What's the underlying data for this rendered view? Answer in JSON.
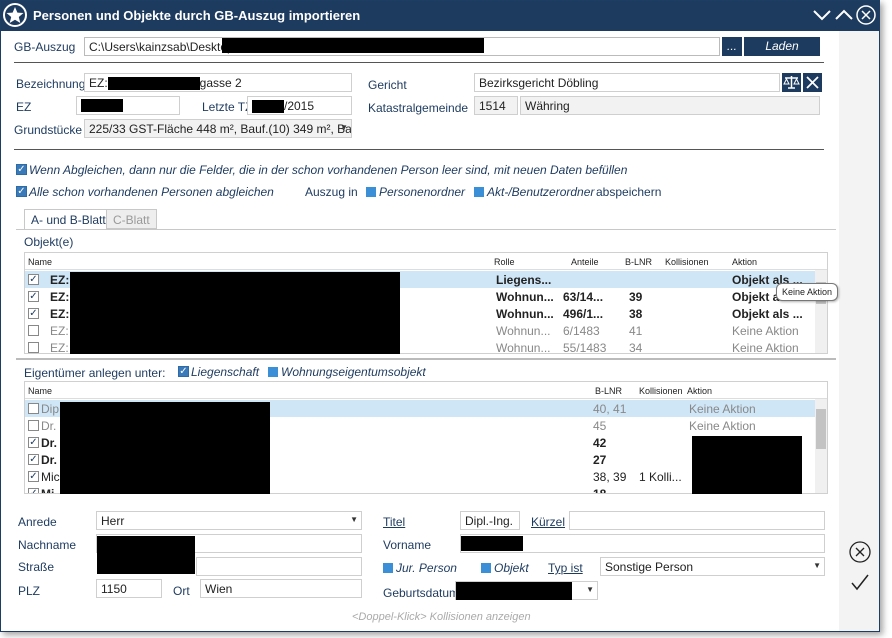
{
  "window": {
    "title": "Personen und Objekte durch GB-Auszug importieren"
  },
  "colors": {
    "titlebar": "#1d3a5f",
    "accent": "#3a8fd6",
    "selection": "#cfe6f7"
  },
  "gb": {
    "label": "GB-Auszug",
    "path": "C:\\Users\\kainzsab\\Desktop\\",
    "browse": "...",
    "load": "Laden"
  },
  "bez": {
    "label": "Bezeichnung",
    "prefix": "EZ:",
    "suffix": "gasse 2"
  },
  "gericht": {
    "label": "Gericht",
    "value": "Bezirksgericht Döbling"
  },
  "ez": {
    "label": "EZ",
    "letzte_tz_label": "Letzte TZ",
    "letzte_tz_suffix": "/2015"
  },
  "kg": {
    "label": "Katastralgemeinde",
    "code": "1514",
    "name": "Währing"
  },
  "grund": {
    "label": "Grundstücke",
    "value": "225/33 GST-Fläche 448 m², Bauf.(10) 349 m², Ba..."
  },
  "opts": {
    "abgleich": "Wenn Abgleichen, dann nur die Felder, die in der schon vorhandenen Person leer sind, mit neuen Daten befüllen",
    "alle": "Alle schon vorhandenen Personen abgleichen",
    "auszug_in": "Auszug in",
    "personenordner": "Personenordner",
    "akt": "Akt-/Benutzerordner",
    "speichern": "abspeichern"
  },
  "tabs": [
    "A- und B-Blatt",
    "C-Blatt"
  ],
  "objekte": {
    "label": "Objekt(e)",
    "headers": [
      "Name",
      "Rolle",
      "Anteile",
      "B-LNR",
      "Kollisionen",
      "Aktion"
    ],
    "rows": [
      {
        "checked": true,
        "name": "EZ:",
        "rolle": "Liegens...",
        "anteile": "",
        "blnr": "",
        "koll": "",
        "aktion": "Objekt als ...",
        "style": "sel bold"
      },
      {
        "checked": true,
        "name": "EZ:",
        "rolle": "Wohnun...",
        "anteile": "63/14...",
        "blnr": "39",
        "koll": "",
        "aktion": "Objekt a",
        "style": "bold"
      },
      {
        "checked": true,
        "name": "EZ:",
        "rolle": "Wohnun...",
        "anteile": "496/1...",
        "blnr": "38",
        "koll": "",
        "aktion": "Objekt als ...",
        "style": "bold"
      },
      {
        "checked": false,
        "name": "EZ:",
        "rolle": "Wohnun...",
        "anteile": "6/1483",
        "blnr": "41",
        "koll": "",
        "aktion": "Keine Aktion",
        "style": "dim"
      },
      {
        "checked": false,
        "name": "EZ:",
        "rolle": "Wohnun...",
        "anteile": "55/1483",
        "blnr": "34",
        "koll": "",
        "aktion": "Keine Aktion",
        "style": "dim"
      }
    ],
    "tooltip": "Keine Aktion"
  },
  "eig": {
    "label": "Eigentümer anlegen unter:",
    "liegenschaft": "Liegenschaft",
    "wohnung": "Wohnungseigentumsobjekt",
    "headers": [
      "Name",
      "B-LNR",
      "Kollisionen",
      "Aktion"
    ],
    "rows": [
      {
        "checked": false,
        "name": "Dip",
        "blnr": "40, 41",
        "koll": "",
        "aktion": "Keine Aktion",
        "style": "sel dim"
      },
      {
        "checked": false,
        "name": "Dr.",
        "blnr": "45",
        "koll": "",
        "aktion": "Keine Aktion",
        "style": "dim"
      },
      {
        "checked": true,
        "name": "Dr.",
        "blnr": "42",
        "koll": "",
        "aktion": "",
        "style": "bold"
      },
      {
        "checked": true,
        "name": "Dr.",
        "blnr": "27",
        "koll": "",
        "aktion": "",
        "style": "bold"
      },
      {
        "checked": true,
        "name": "Mic",
        "blnr": "38, 39",
        "koll": "1 Kolli...",
        "aktion": "",
        "style": ""
      },
      {
        "checked": true,
        "name": "Mi",
        "blnr": "18",
        "koll": "",
        "aktion": "",
        "style": "bold"
      }
    ]
  },
  "person": {
    "anrede_label": "Anrede",
    "anrede": "Herr",
    "titel_label": "Titel",
    "titel": "Dipl.-Ing.",
    "kuerzel_label": "Kürzel",
    "kuerzel": "",
    "nachname_label": "Nachname",
    "vorname_label": "Vorname",
    "strasse_label": "Straße",
    "jur": "Jur. Person",
    "objekt": "Objekt",
    "typ_label": "Typ ist",
    "typ": "Sonstige Person",
    "plz_label": "PLZ",
    "plz": "1150",
    "ort_label": "Ort",
    "ort": "Wien",
    "geb_label": "Geburtsdatum"
  },
  "footer": {
    "hint": "<Doppel-Klick> Kollisionen anzeigen"
  }
}
